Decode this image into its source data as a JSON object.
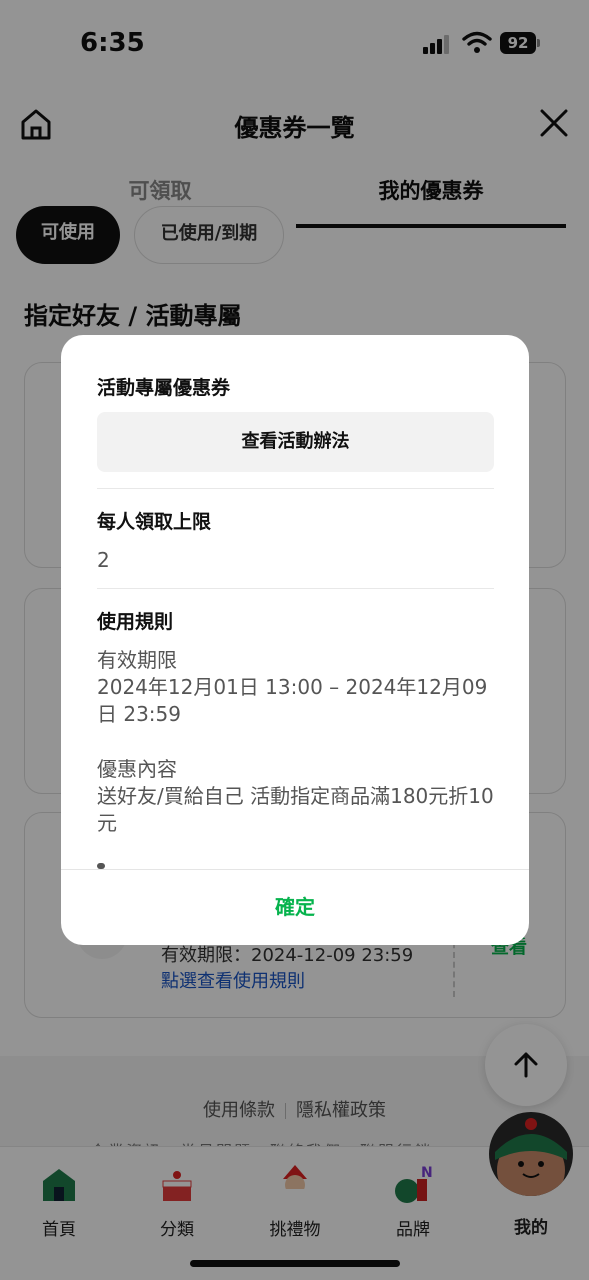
{
  "status_bar": {
    "time": "6:35",
    "battery": "92"
  },
  "header": {
    "title": "優惠券一覽"
  },
  "tabs": [
    {
      "label": "可領取"
    },
    {
      "label": "我的優惠券"
    }
  ],
  "filters": [
    {
      "label": "可使用"
    },
    {
      "label": "已使用/到期"
    }
  ],
  "section": {
    "title": "指定好友 / 活動專屬"
  },
  "coupon_card": {
    "expiry": "有效期限：2024-12-09 23:59",
    "rules_link": "點選查看使用規則",
    "action": "查看"
  },
  "footer": {
    "terms": "使用條款",
    "privacy": "隱私權政策",
    "more": "企業資訊　常見問題　聯絡我們　聯盟行銷"
  },
  "bottom_nav": [
    {
      "label": "首頁"
    },
    {
      "label": "分類"
    },
    {
      "label": "挑禮物"
    },
    {
      "label": "品牌"
    },
    {
      "label": "我的"
    }
  ],
  "modal": {
    "title": "活動專屬優惠券",
    "view_rules_button": "查看活動辦法",
    "limit_heading": "每人領取上限",
    "limit_value": "2",
    "rules_heading": "使用規則",
    "validity_label": "有效期限",
    "validity_value": "2024年12月01日 13:00 – 2024年12月09日 23:59",
    "content_label": "優惠內容",
    "content_value": "送好友/買給自己 活動指定商品滿180元折10元",
    "confirm_button": "確定"
  },
  "colors": {
    "accent_green": "#06b34d",
    "link_blue": "#1a55c4"
  }
}
